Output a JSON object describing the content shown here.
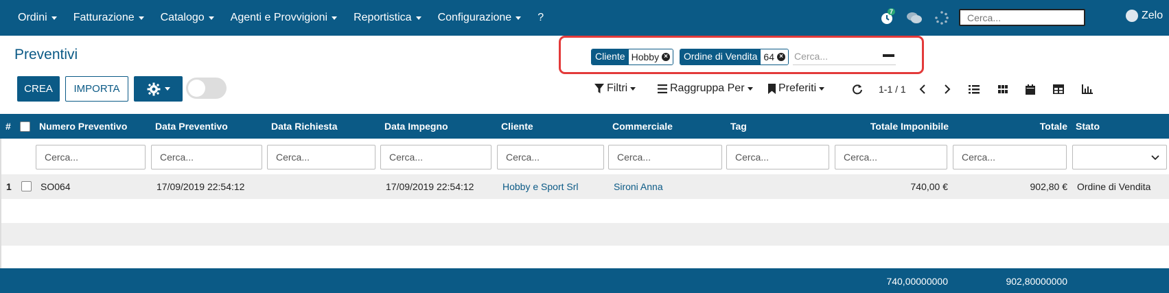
{
  "nav": {
    "items": [
      {
        "label": "Ordini",
        "caret": true
      },
      {
        "label": "Fatturazione",
        "caret": true
      },
      {
        "label": "Catalogo",
        "caret": true
      },
      {
        "label": "Agenti e Provvigioni",
        "caret": true
      },
      {
        "label": "Reportistica",
        "caret": true
      },
      {
        "label": "Configurazione",
        "caret": true
      },
      {
        "label": "?",
        "caret": false
      }
    ],
    "activity_badge": "7",
    "search_placeholder": "Cerca...",
    "user_name": "Zelo"
  },
  "page": {
    "title": "Preventivi",
    "create_label": "CREA",
    "import_label": "IMPORTA"
  },
  "search": {
    "facets": [
      {
        "category": "Cliente",
        "value": "Hobby"
      },
      {
        "category": "Ordine di Vendita",
        "value": "64"
      }
    ],
    "placeholder": "Cerca..."
  },
  "controls": {
    "filters_label": "Filtri",
    "groupby_label": "Raggruppa Per",
    "favorites_label": "Preferiti",
    "pager": "1-1 / 1"
  },
  "table": {
    "hash": "#",
    "columns": [
      "Numero Preventivo",
      "Data Preventivo",
      "Data Richiesta",
      "Data Impegno",
      "Cliente",
      "Commerciale",
      "Tag",
      "Totale Imponibile",
      "Totale",
      "Stato"
    ],
    "filter_placeholder": "Cerca...",
    "rows": [
      {
        "index": "1",
        "numero": "SO064",
        "data_preventivo": "17/09/2019 22:54:12",
        "data_richiesta": "",
        "data_impegno": "17/09/2019 22:54:12",
        "cliente": "Hobby e Sport Srl",
        "commerciale": "Sironi Anna",
        "tag": "",
        "totale_imponibile": "740,00 €",
        "totale": "902,80 €",
        "stato": "Ordine di Vendita"
      }
    ],
    "footer": {
      "totale_imponibile": "740,00000000",
      "totale": "902,80000000"
    }
  },
  "colors": {
    "primary": "#0b5a86",
    "highlight": "#e33a3a"
  }
}
